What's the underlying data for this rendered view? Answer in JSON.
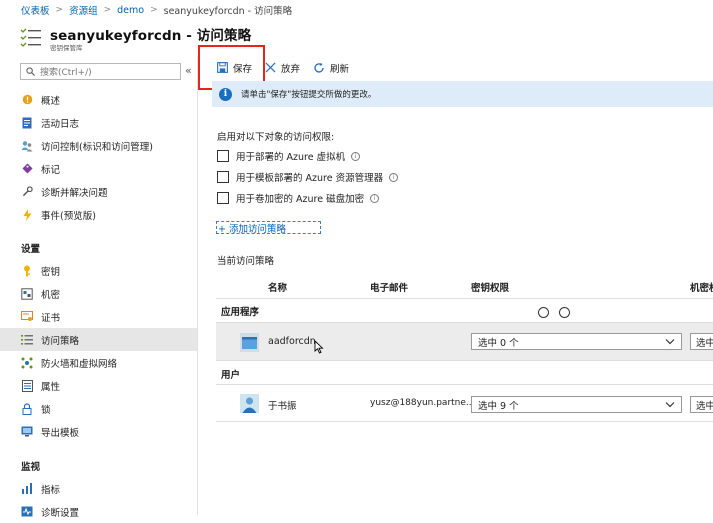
{
  "breadcrumb": {
    "items": [
      "仪表板",
      "资源组",
      "demo",
      "seanyukeyforcdn - 访问策略"
    ],
    "separator": ">"
  },
  "header": {
    "title": "seanyukeyforcdn - 访问策略",
    "subtitle": "密钥保管库",
    "icon": "list-policy-icon"
  },
  "sidebar": {
    "search_placeholder": "搜索(Ctrl+/)",
    "collapse": "«",
    "items_top": [
      {
        "label": "概述",
        "icon": "overview-icon"
      },
      {
        "label": "活动日志",
        "icon": "activity-log-icon"
      },
      {
        "label": "访问控制(标识和访问管理)",
        "icon": "iam-icon"
      },
      {
        "label": "标记",
        "icon": "tag-icon"
      },
      {
        "label": "诊断并解决问题",
        "icon": "wrench-icon"
      },
      {
        "label": "事件(预览版)",
        "icon": "lightning-icon"
      }
    ],
    "section_settings": "设置",
    "items_settings": [
      {
        "label": "密钥",
        "icon": "key-icon"
      },
      {
        "label": "机密",
        "icon": "secret-icon"
      },
      {
        "label": "证书",
        "icon": "certificate-icon"
      },
      {
        "label": "访问策略",
        "icon": "access-policy-icon",
        "active": true
      },
      {
        "label": "防火墙和虚拟网络",
        "icon": "firewall-icon"
      },
      {
        "label": "属性",
        "icon": "properties-icon"
      },
      {
        "label": "锁",
        "icon": "lock-icon"
      },
      {
        "label": "导出模板",
        "icon": "export-template-icon"
      }
    ],
    "section_monitor": "监视",
    "items_monitor": [
      {
        "label": "指标",
        "icon": "metrics-icon"
      },
      {
        "label": "诊断设置",
        "icon": "diagnostics-icon"
      }
    ]
  },
  "toolbar": {
    "save": "保存",
    "discard": "放弃",
    "refresh": "刷新"
  },
  "info_bar": {
    "text": "请单击\"保存\"按钮提交所做的更改。"
  },
  "access": {
    "enable_label": "启用对以下对象的访问权限:",
    "checkboxes": [
      {
        "label": "用于部署的 Azure 虚拟机",
        "checked": false
      },
      {
        "label": "用于模板部署的 Azure 资源管理器",
        "checked": false
      },
      {
        "label": "用于卷加密的 Azure 磁盘加密",
        "checked": false
      }
    ],
    "add_policy": "+ 添加访问策略",
    "current_label": "当前访问策略"
  },
  "table": {
    "headers": [
      "名称",
      "电子邮件",
      "密钥权限",
      "机密权"
    ],
    "groups": [
      {
        "label": "应用程序",
        "rows": [
          {
            "name": "aadforcdn",
            "email": "",
            "key_perm": "选中 0 个",
            "secret_perm": "选中",
            "avatar": "app-avatar"
          }
        ]
      },
      {
        "label": "用户",
        "rows": [
          {
            "name": "于书振",
            "email": "yusz@188yun.partne...",
            "key_perm": "选中 9 个",
            "secret_perm": "选中",
            "avatar": "user-avatar"
          }
        ]
      }
    ]
  },
  "colors": {
    "accent": "#0062ad",
    "info_bg": "#deecf9",
    "highlight": "#e8241f",
    "active_nav": "#e6e6e6"
  }
}
